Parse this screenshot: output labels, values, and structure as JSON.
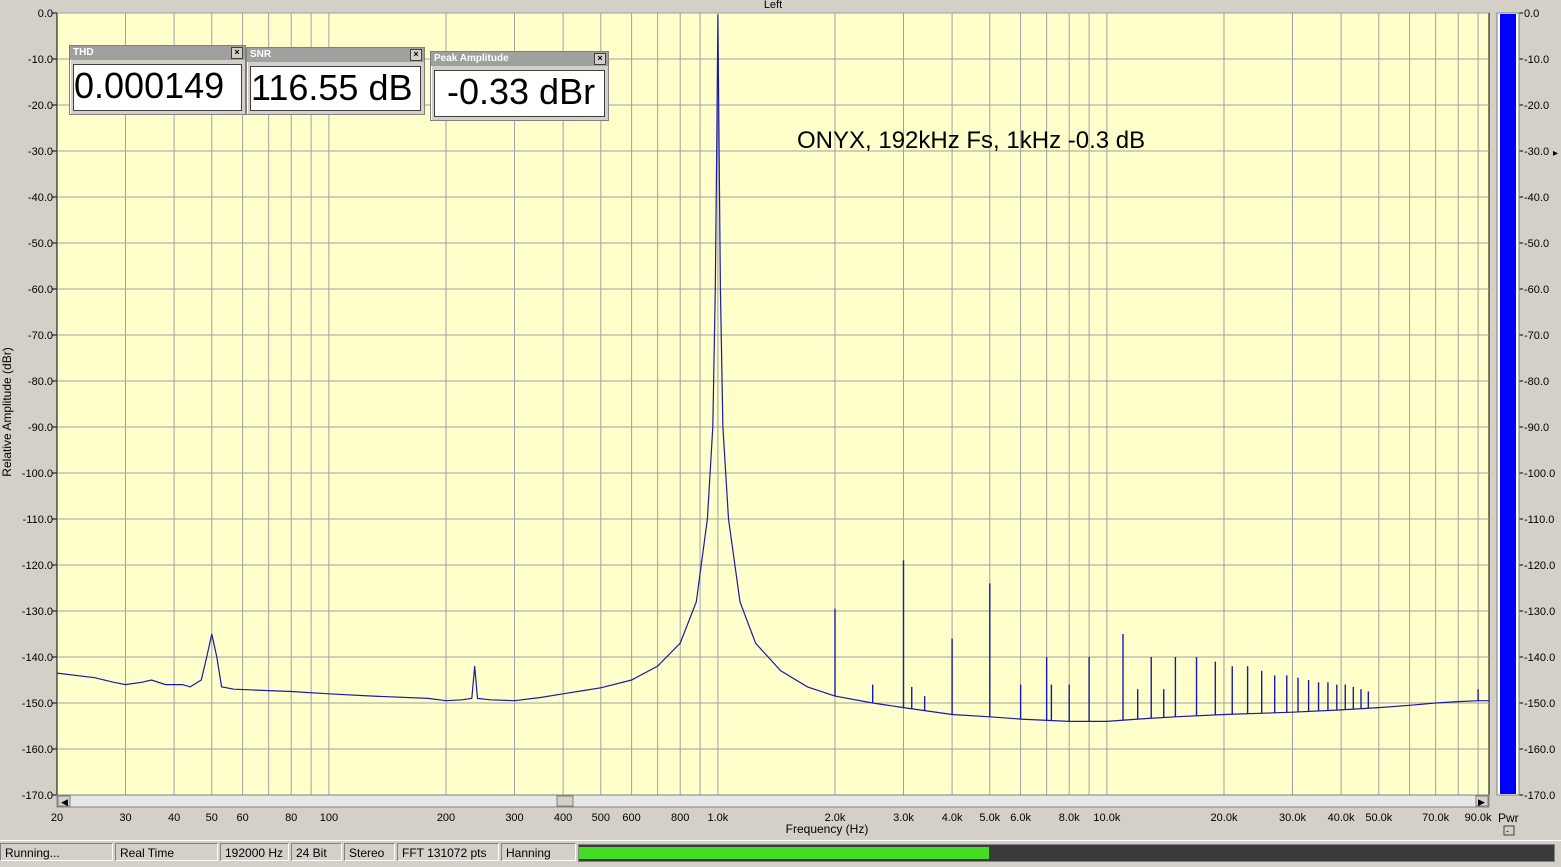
{
  "window": {
    "panel_title": "Left"
  },
  "annotation": "ONYX, 192kHz Fs, 1kHz -0.3 dB",
  "widgets": {
    "thd": {
      "title": "THD",
      "value": "0.000149"
    },
    "snr": {
      "title": "SNR",
      "value": "116.55 dB"
    },
    "peak": {
      "title": "Peak Amplitude",
      "value": "-0.33 dBr"
    }
  },
  "status": {
    "state": "Running...",
    "mode": "Real Time",
    "sample_rate": "192000 Hz",
    "bit_depth": "24 Bit",
    "channels": "Stereo",
    "fft": "FFT 131072 pts",
    "window_fn": "Hanning",
    "level_fraction": 0.42
  },
  "colors": {
    "plot_bg": "#ffffcc",
    "trace": "#1a1aa8",
    "meter_bar": "#0000ff",
    "grid": "#a0a0a0",
    "level_green": "#44dd22"
  },
  "pwr_meter": {
    "label": "Pwr",
    "value_db": 0.0
  },
  "chart_data": {
    "type": "line",
    "title": "",
    "xlabel": "Frequency (Hz)",
    "ylabel": "Relative Amplitude (dBr)",
    "x_scale": "log",
    "xlim": [
      20,
      96000
    ],
    "ylim": [
      -170,
      0
    ],
    "x_ticks": [
      {
        "v": 20,
        "label": "20"
      },
      {
        "v": 30,
        "label": "30"
      },
      {
        "v": 40,
        "label": "40"
      },
      {
        "v": 50,
        "label": "50"
      },
      {
        "v": 60,
        "label": "60"
      },
      {
        "v": 80,
        "label": "80"
      },
      {
        "v": 100,
        "label": "100"
      },
      {
        "v": 200,
        "label": "200"
      },
      {
        "v": 300,
        "label": "300"
      },
      {
        "v": 400,
        "label": "400"
      },
      {
        "v": 500,
        "label": "500"
      },
      {
        "v": 600,
        "label": "600"
      },
      {
        "v": 800,
        "label": "800"
      },
      {
        "v": 1000,
        "label": "1.0k"
      },
      {
        "v": 2000,
        "label": "2.0k"
      },
      {
        "v": 3000,
        "label": "3.0k"
      },
      {
        "v": 4000,
        "label": "4.0k"
      },
      {
        "v": 5000,
        "label": "5.0k"
      },
      {
        "v": 6000,
        "label": "6.0k"
      },
      {
        "v": 8000,
        "label": "8.0k"
      },
      {
        "v": 10000,
        "label": "10.0k"
      },
      {
        "v": 20000,
        "label": "20.0k"
      },
      {
        "v": 30000,
        "label": "30.0k"
      },
      {
        "v": 40000,
        "label": "40.0k"
      },
      {
        "v": 50000,
        "label": "50.0k"
      },
      {
        "v": 70000,
        "label": "70.0k"
      },
      {
        "v": 90000,
        "label": "90.0k"
      }
    ],
    "y_ticks": [
      "0.0",
      "-10.0",
      "-20.0",
      "-30.0",
      "-40.0",
      "-50.0",
      "-60.0",
      "-70.0",
      "-80.0",
      "-90.0",
      "-100.0",
      "-110.0",
      "-120.0",
      "-130.0",
      "-140.0",
      "-150.0",
      "-160.0",
      "-170.0"
    ],
    "grid": true,
    "legend": "none",
    "series": [
      {
        "points": [
          [
            20,
            -143.5
          ],
          [
            25,
            -144.5
          ],
          [
            28,
            -145.5
          ],
          [
            30,
            -146
          ],
          [
            33,
            -145.5
          ],
          [
            35,
            -145
          ],
          [
            38,
            -146
          ],
          [
            42,
            -146
          ],
          [
            44,
            -146.5
          ],
          [
            47,
            -145
          ],
          [
            48.5,
            -140
          ],
          [
            50,
            -135
          ],
          [
            51.5,
            -140
          ],
          [
            53,
            -146.5
          ],
          [
            57,
            -147
          ],
          [
            65,
            -147.2
          ],
          [
            80,
            -147.5
          ],
          [
            100,
            -148
          ],
          [
            130,
            -148.5
          ],
          [
            180,
            -149
          ],
          [
            200,
            -149.5
          ],
          [
            220,
            -149.3
          ],
          [
            233,
            -149
          ],
          [
            237,
            -142
          ],
          [
            241,
            -149
          ],
          [
            260,
            -149.3
          ],
          [
            300,
            -149.5
          ],
          [
            350,
            -148.8
          ],
          [
            400,
            -148
          ],
          [
            450,
            -147.3
          ],
          [
            500,
            -146.7
          ],
          [
            600,
            -145
          ],
          [
            700,
            -142
          ],
          [
            800,
            -137
          ],
          [
            880,
            -128
          ],
          [
            940,
            -110
          ],
          [
            970,
            -90
          ],
          [
            985,
            -60
          ],
          [
            993,
            -30
          ],
          [
            1000,
            -0.33
          ],
          [
            1007,
            -30
          ],
          [
            1015,
            -60
          ],
          [
            1030,
            -90
          ],
          [
            1065,
            -110
          ],
          [
            1140,
            -128
          ],
          [
            1250,
            -137
          ],
          [
            1450,
            -143
          ],
          [
            1700,
            -146.5
          ],
          [
            2000,
            -148.5
          ],
          [
            2500,
            -150
          ],
          [
            3000,
            -151
          ],
          [
            4000,
            -152.5
          ],
          [
            5000,
            -153
          ],
          [
            6000,
            -153.5
          ],
          [
            8000,
            -154
          ],
          [
            10000,
            -154
          ],
          [
            12000,
            -153.5
          ],
          [
            15000,
            -153
          ],
          [
            20000,
            -152.5
          ],
          [
            30000,
            -152
          ],
          [
            40000,
            -151.5
          ],
          [
            50000,
            -151
          ],
          [
            60000,
            -150.5
          ],
          [
            70000,
            -150
          ],
          [
            80000,
            -149.7
          ],
          [
            90000,
            -149.5
          ],
          [
            96000,
            -149.5
          ]
        ],
        "spurs": [
          {
            "f": 2000,
            "db": -129.5
          },
          {
            "f": 2500,
            "db": -146
          },
          {
            "f": 3000,
            "db": -119
          },
          {
            "f": 3150,
            "db": -146.5
          },
          {
            "f": 3400,
            "db": -148.5
          },
          {
            "f": 4000,
            "db": -136
          },
          {
            "f": 5000,
            "db": -124
          },
          {
            "f": 6000,
            "db": -146
          },
          {
            "f": 7000,
            "db": -140
          },
          {
            "f": 7200,
            "db": -146
          },
          {
            "f": 8000,
            "db": -146
          },
          {
            "f": 9000,
            "db": -140
          },
          {
            "f": 11000,
            "db": -135
          },
          {
            "f": 12000,
            "db": -147
          },
          {
            "f": 13000,
            "db": -140
          },
          {
            "f": 14000,
            "db": -147
          },
          {
            "f": 15000,
            "db": -140
          },
          {
            "f": 17000,
            "db": -140
          },
          {
            "f": 19000,
            "db": -141
          },
          {
            "f": 21000,
            "db": -142
          },
          {
            "f": 23000,
            "db": -142
          },
          {
            "f": 25000,
            "db": -143
          },
          {
            "f": 27000,
            "db": -144
          },
          {
            "f": 29000,
            "db": -144
          },
          {
            "f": 31000,
            "db": -144.5
          },
          {
            "f": 33000,
            "db": -145
          },
          {
            "f": 35000,
            "db": -145.5
          },
          {
            "f": 37000,
            "db": -145.5
          },
          {
            "f": 39000,
            "db": -146
          },
          {
            "f": 41000,
            "db": -146
          },
          {
            "f": 43000,
            "db": -146.5
          },
          {
            "f": 45000,
            "db": -147
          },
          {
            "f": 47000,
            "db": -147.5
          },
          {
            "f": 90000,
            "db": -147
          }
        ]
      }
    ]
  }
}
